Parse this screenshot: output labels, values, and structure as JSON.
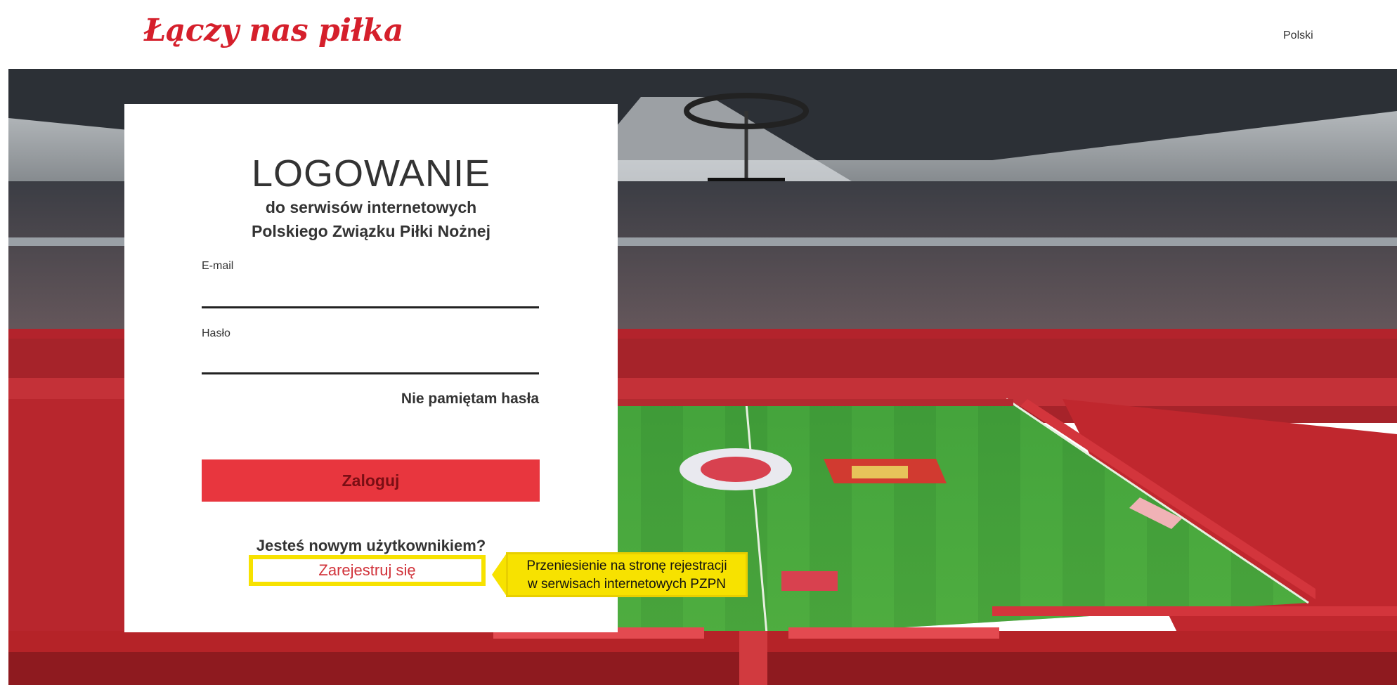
{
  "header": {
    "logo_text": "Łączy nas piłka",
    "language_label": "Polski"
  },
  "login": {
    "title": "LOGOWANIE",
    "subtitle_line1": "do serwisów internetowych",
    "subtitle_line2": "Polskiego Związku Piłki Nożnej",
    "email_label": "E-mail",
    "email_value": "",
    "password_label": "Hasło",
    "password_value": "",
    "forgot_password": "Nie pamiętam hasła",
    "submit_label": "Zaloguj",
    "new_user_text": "Jesteś nowym użytkownikiem?",
    "register_label": "Zarejestruj się"
  },
  "annotation": {
    "line1": "Przeniesienie na stronę rejestracji",
    "line2": "w serwisach internetowych PZPN"
  },
  "colors": {
    "brand_red": "#d51f2b",
    "button_red": "#e8363e",
    "highlight_yellow": "#f7e200"
  }
}
